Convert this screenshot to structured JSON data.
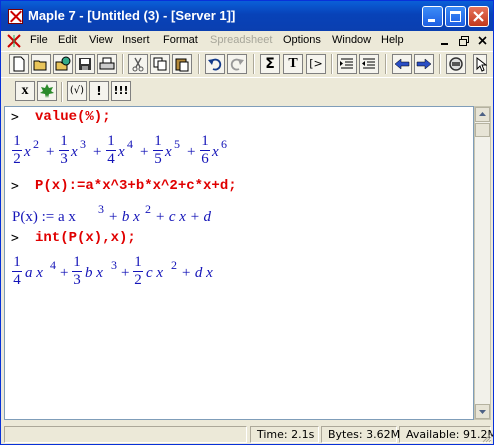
{
  "window": {
    "title": "Maple 7 - [Untitled (3) - [Server 1]]"
  },
  "menu": [
    {
      "label": "File",
      "enabled": true
    },
    {
      "label": "Edit",
      "enabled": true
    },
    {
      "label": "View",
      "enabled": true
    },
    {
      "label": "Insert",
      "enabled": true
    },
    {
      "label": "Format",
      "enabled": true
    },
    {
      "label": "Spreadsheet",
      "enabled": false
    },
    {
      "label": "Options",
      "enabled": true
    },
    {
      "label": "Window",
      "enabled": true
    },
    {
      "label": "Help",
      "enabled": true
    }
  ],
  "toolbar": {
    "icons": [
      "new-document-icon",
      "open-icon",
      "open-url-icon",
      "save-icon",
      "print-icon",
      "cut-icon",
      "copy-icon",
      "paste-icon",
      "undo-icon",
      "redo-icon",
      "sigma-icon",
      "text-icon",
      "prompt-icon",
      "expand-section-icon",
      "collapse-section-icon",
      "back-icon",
      "forward-icon",
      "stop-icon",
      "help-cursor-icon"
    ],
    "sigma_label": "Σ",
    "text_label": "T",
    "prompt_label": "[>"
  },
  "toolbar2": {
    "x_label": "x",
    "valid_label": "(√)",
    "exec_label": "!",
    "exec_all_label": "!!!"
  },
  "worksheet": {
    "prompt": ">",
    "inputs": [
      "value(%);",
      "P(x):=a*x^3+b*x^2+c*x+d;",
      "int(P(x),x);"
    ],
    "output1": {
      "terms": [
        {
          "num": "1",
          "den": "2",
          "var": "x",
          "exp": "2"
        },
        {
          "num": "1",
          "den": "3",
          "var": "x",
          "exp": "3"
        },
        {
          "num": "1",
          "den": "4",
          "var": "x",
          "exp": "4"
        },
        {
          "num": "1",
          "den": "5",
          "var": "x",
          "exp": "5"
        },
        {
          "num": "1",
          "den": "6",
          "var": "x",
          "exp": "6"
        }
      ],
      "plus": "+"
    },
    "output2": {
      "lhs": "P(x) := a x",
      "e3": "3",
      "t2": "+ b x",
      "e2": "2",
      "t3": "+ c x + d"
    },
    "output3": {
      "f1": {
        "num": "1",
        "den": "4"
      },
      "t1": "a x",
      "e1": "4",
      "f2": {
        "num": "1",
        "den": "3"
      },
      "t2": "b x",
      "e2": "3",
      "f3": {
        "num": "1",
        "den": "2"
      },
      "t3": "c x",
      "e3": "2",
      "tail": "+ d x",
      "plus": "+"
    }
  },
  "status": {
    "time": "Time:  2.1s",
    "bytes": "Bytes: 3.62M",
    "available": "Available: 91.2M"
  }
}
